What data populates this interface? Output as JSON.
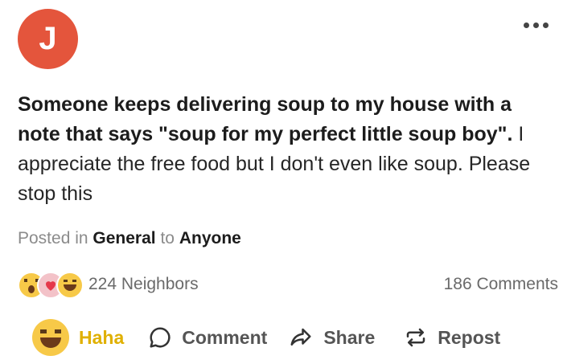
{
  "author": {
    "avatar_initial": "J",
    "avatar_color": "#e4553c"
  },
  "post": {
    "bold_text": "Someone keeps delivering soup to my house with a note that says \"soup for my perfect little soup boy\".",
    "regular_text": " I appreciate the free food but I don't even like soup. Please stop this"
  },
  "meta": {
    "posted_in_label": "Posted in",
    "category": "General",
    "to_label": "to",
    "audience": "Anyone"
  },
  "reactions": {
    "icons": [
      "wow-icon",
      "love-icon",
      "haha-icon"
    ],
    "count_label": "224 Neighbors",
    "comments_label": "186 Comments"
  },
  "actions": {
    "haha_label": "Haha",
    "comment_label": "Comment",
    "share_label": "Share",
    "repost_label": "Repost",
    "haha_color": "#e0b000"
  }
}
